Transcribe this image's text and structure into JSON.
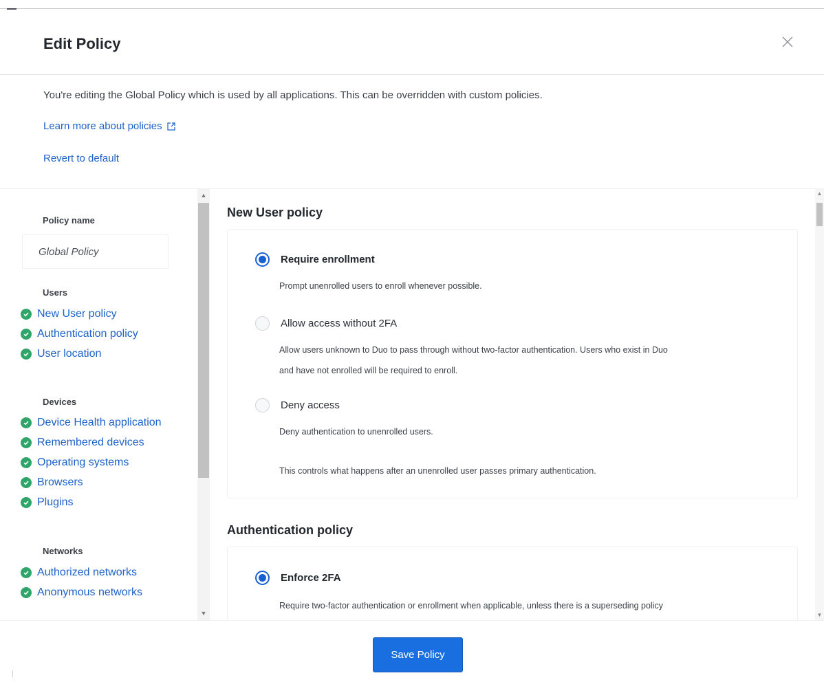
{
  "dialog": {
    "title": "Edit Policy",
    "intro": "You're editing the Global Policy which is used by all applications. This can be overridden with custom policies.",
    "learn_more": "Learn more about policies",
    "revert": "Revert to default",
    "save_label": "Save Policy"
  },
  "sidebar": {
    "policy_name_label": "Policy name",
    "policy_name_value": "Global Policy",
    "users_label": "Users",
    "users_items": [
      "New User policy",
      "Authentication policy",
      "User location"
    ],
    "devices_label": "Devices",
    "devices_items": [
      "Device Health application",
      "Remembered devices",
      "Operating systems",
      "Browsers",
      "Plugins"
    ],
    "networks_label": "Networks",
    "networks_items": [
      "Authorized networks",
      "Anonymous networks"
    ]
  },
  "new_user_policy": {
    "title": "New User policy",
    "options": [
      {
        "label": "Require enrollment",
        "desc": "Prompt unenrolled users to enroll whenever possible.",
        "selected": true
      },
      {
        "label": "Allow access without 2FA",
        "desc1": "Allow users unknown to Duo to pass through without two-factor authentication. Users who exist in Duo",
        "desc2": "and have not enrolled will be required to enroll.",
        "selected": false
      },
      {
        "label": "Deny access",
        "desc": "Deny authentication to unenrolled users.",
        "selected": false
      }
    ],
    "footnote": "This controls what happens after an unenrolled user passes primary authentication."
  },
  "authentication_policy": {
    "title": "Authentication policy",
    "options": [
      {
        "label": "Enforce 2FA",
        "desc": "Require two-factor authentication or enrollment when applicable, unless there is a superseding policy",
        "selected": true
      }
    ]
  },
  "colors": {
    "link": "#1e62c9",
    "check": "#31a46a",
    "primary": "#1a6fe0"
  }
}
